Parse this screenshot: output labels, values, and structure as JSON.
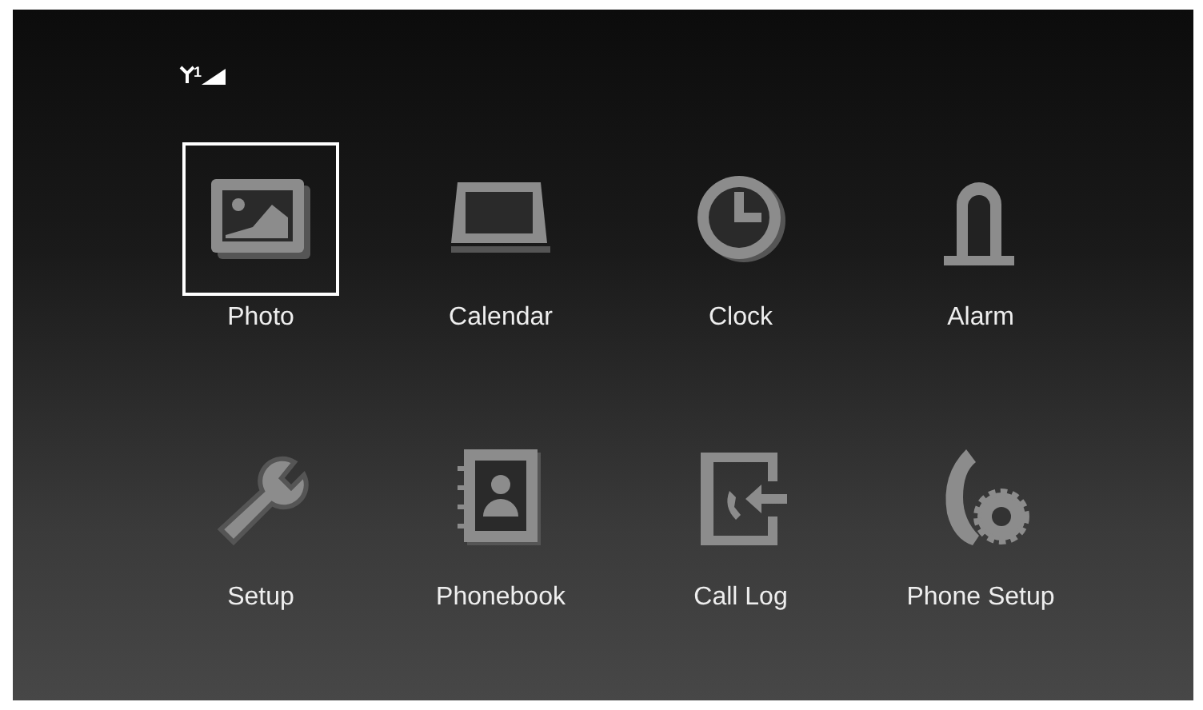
{
  "status_bar": {
    "signal_line": "1"
  },
  "menu_items": [
    {
      "kind": "photo",
      "label": "Photo",
      "selected": true
    },
    {
      "kind": "calendar",
      "label": "Calendar",
      "selected": false
    },
    {
      "kind": "clock",
      "label": "Clock",
      "selected": false
    },
    {
      "kind": "alarm",
      "label": "Alarm",
      "selected": false
    },
    {
      "kind": "setup",
      "label": "Setup",
      "selected": false
    },
    {
      "kind": "phonebook",
      "label": "Phonebook",
      "selected": false
    },
    {
      "kind": "calllog",
      "label": "Call Log",
      "selected": false
    },
    {
      "kind": "phonesetup",
      "label": "Phone Setup",
      "selected": false
    }
  ]
}
